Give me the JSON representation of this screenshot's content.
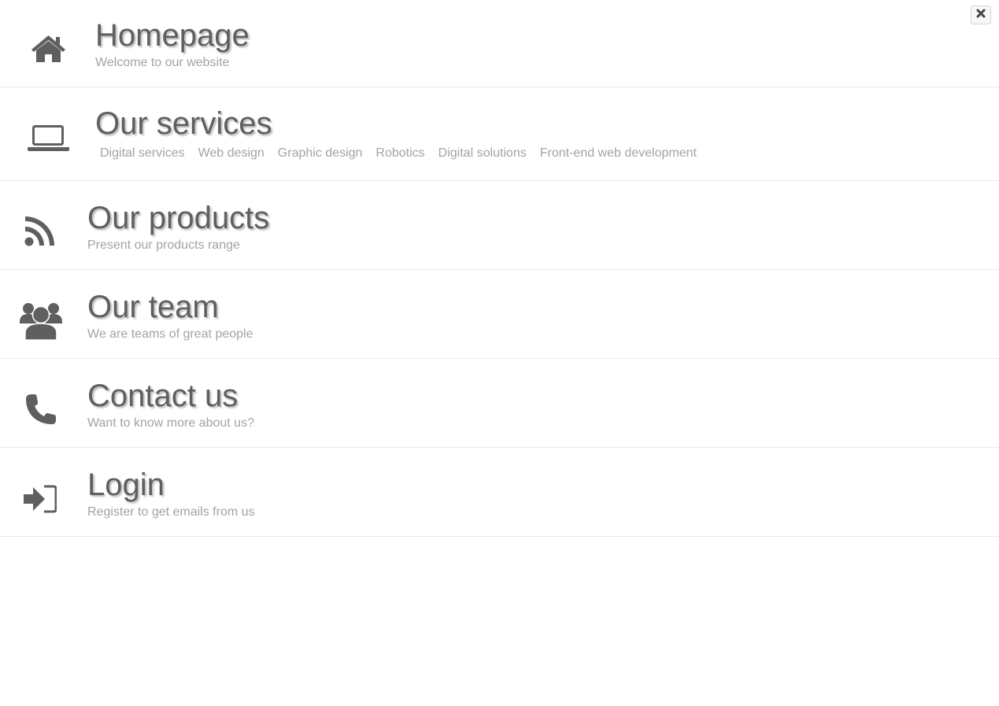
{
  "menu": {
    "items": [
      {
        "id": "homepage",
        "title": "Homepage",
        "subtitle": "Welcome to our website",
        "icon": "home-icon"
      },
      {
        "id": "services",
        "title": "Our services",
        "icon": "laptop-icon",
        "links": [
          "Digital services",
          "Web design",
          "Graphic design",
          "Robotics",
          "Digital solutions",
          "Front-end web development"
        ]
      },
      {
        "id": "products",
        "title": "Our products",
        "subtitle": "Present our products range",
        "icon": "rss-icon"
      },
      {
        "id": "team",
        "title": "Our team",
        "subtitle": "We are teams of great people",
        "icon": "users-icon"
      },
      {
        "id": "contact",
        "title": "Contact us",
        "subtitle": "Want to know more about us?",
        "icon": "phone-icon"
      },
      {
        "id": "login",
        "title": "Login",
        "subtitle": "Register to get emails from us",
        "icon": "sign-in-icon"
      }
    ]
  },
  "close": {
    "icon": "close-icon"
  },
  "colors": {
    "title": "#5f5f5f",
    "subtitle": "#a3a3a3",
    "icon": "#5f5f5f",
    "divider": "#e9e9e9"
  }
}
